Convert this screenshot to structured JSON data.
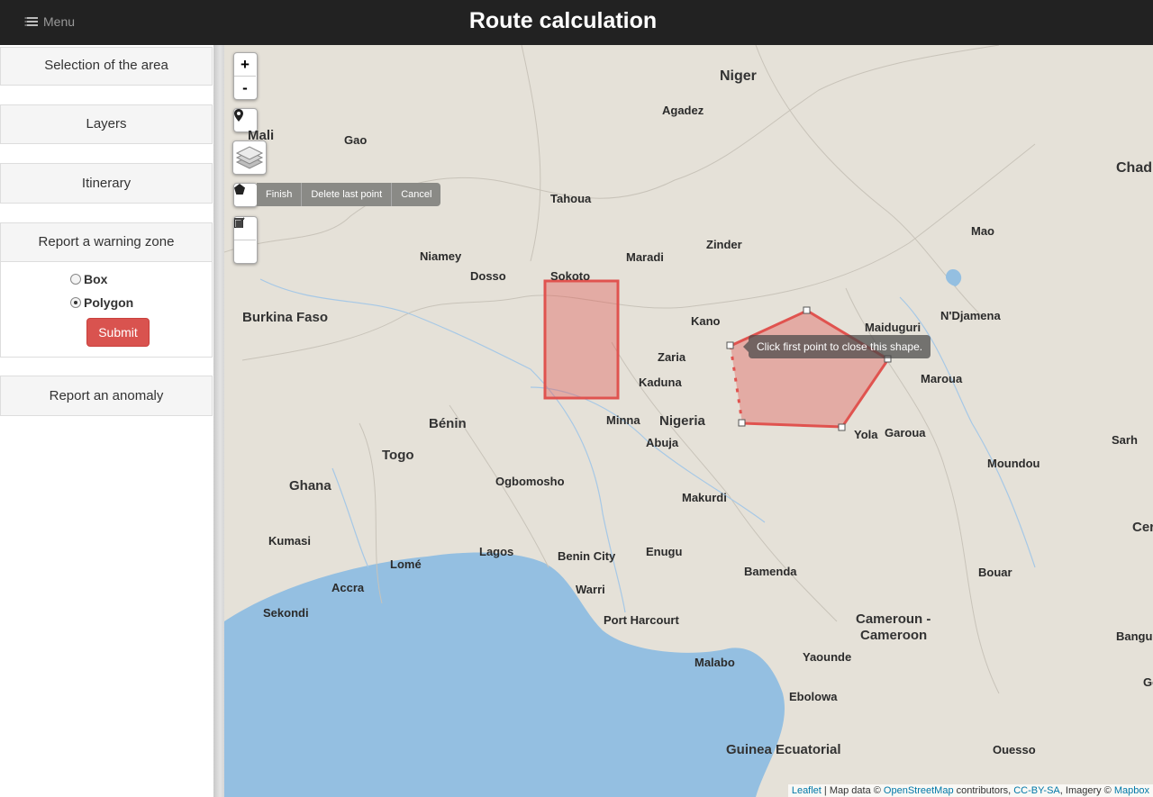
{
  "header": {
    "menu_label": "Menu",
    "title": "Route calculation"
  },
  "sidebar": {
    "panels": [
      "Selection of the area",
      "Layers",
      "Itinerary",
      "Report a warning zone",
      "Report an anomaly"
    ],
    "warning_zone": {
      "options": [
        {
          "label": "Box",
          "checked": false
        },
        {
          "label": "Polygon",
          "checked": true
        }
      ],
      "submit_label": "Submit"
    }
  },
  "map": {
    "controls": {
      "zoom_in": "+",
      "zoom_out": "-"
    },
    "draw_actions": [
      "Finish",
      "Delete last point",
      "Cancel"
    ],
    "tooltip": "Click first point to close this shape.",
    "countries": [
      "Niger",
      "Mali",
      "Chad",
      "Burkina Faso",
      "Bénin",
      "Togo",
      "Nigeria",
      "Ghana",
      "Cameroun -",
      "Cameroon",
      "Guinea Ecuatorial",
      "Cer"
    ],
    "cities": [
      "Agadez",
      "Gao",
      "Tahoua",
      "Mao",
      "Niamey",
      "Dosso",
      "Maradi",
      "Zinder",
      "Sokoto",
      "Kano",
      "Maiduguri",
      "N'Djamena",
      "Zaria",
      "Maroua",
      "Kaduna",
      "Minna",
      "Abuja",
      "Yola",
      "Garoua",
      "Sarh",
      "Moundou",
      "Ogbomosho",
      "Makurdi",
      "Kumasi",
      "Lomé",
      "Lagos",
      "Benin City",
      "Enugu",
      "Bamenda",
      "Bouar",
      "Accra",
      "Warri",
      "Bangui",
      "Sekondi",
      "Port Harcourt",
      "Yaounde",
      "Malabo",
      "Ebolowa",
      "Ouesso",
      "Ge"
    ],
    "attribution": {
      "leaflet": "Leaflet",
      "sep": " | Map data © ",
      "osm": "OpenStreetMap",
      "contrib": " contributors, ",
      "license": "CC-BY-SA",
      "imagery": ", Imagery © ",
      "mapbox": "Mapbox"
    },
    "colors": {
      "sea": "#94bfe1",
      "land": "#e5e1d8",
      "shape": "#e0534f"
    }
  }
}
